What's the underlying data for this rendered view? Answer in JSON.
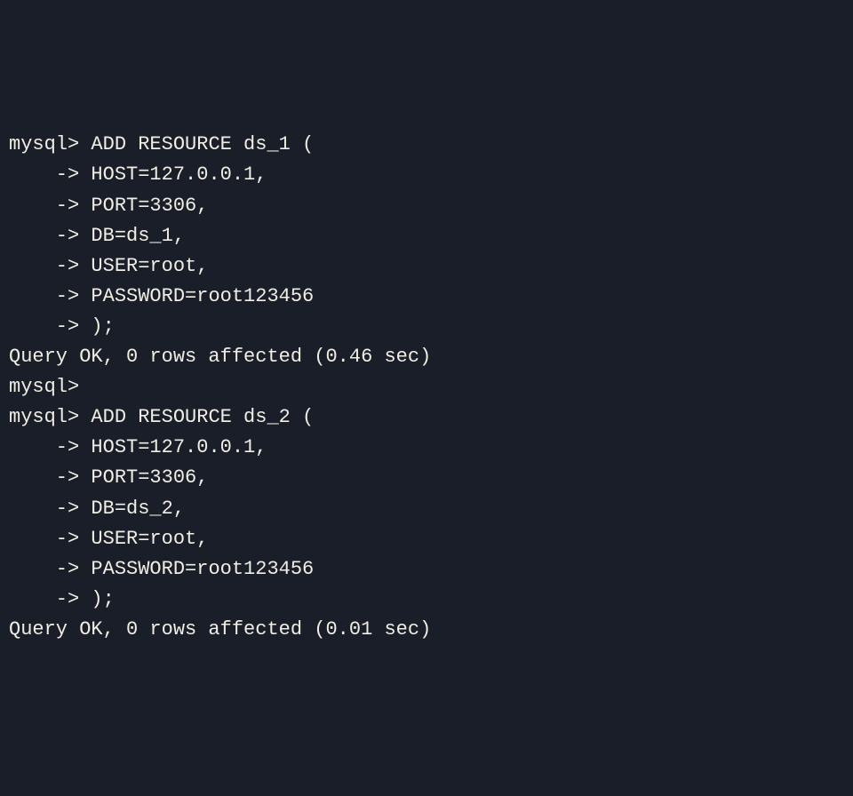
{
  "prompt_main": "mysql>",
  "prompt_cont": "    ->",
  "block1": {
    "line1": " ADD RESOURCE ds_1 (",
    "line2": " HOST=127.0.0.1,",
    "line3": " PORT=3306,",
    "line4": " DB=ds_1,",
    "line5": " USER=root,",
    "line6": " PASSWORD=root123456",
    "line7": " );",
    "result": "Query OK, 0 rows affected (0.46 sec)"
  },
  "blank": "",
  "empty_prompt_suffix": " ",
  "block2": {
    "line1": " ADD RESOURCE ds_2 (",
    "line2": " HOST=127.0.0.1,",
    "line3": " PORT=3306,",
    "line4": " DB=ds_2,",
    "line5": " USER=root,",
    "line6": " PASSWORD=root123456",
    "line7": " );",
    "result": "Query OK, 0 rows affected (0.01 sec)"
  }
}
